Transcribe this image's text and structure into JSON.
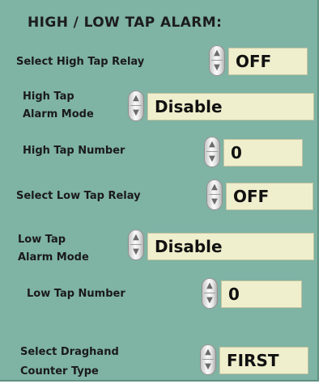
{
  "title": "HIGH / LOW TAP ALARM:",
  "controls": [
    {
      "label": "Select High Tap Relay",
      "value": "OFF"
    },
    {
      "label_lines": [
        "High Tap",
        "Alarm Mode"
      ],
      "value": "Disable"
    },
    {
      "label": "High Tap Number",
      "value": "0"
    },
    {
      "label": "Select Low Tap Relay",
      "value": "OFF"
    },
    {
      "label_lines": [
        "Low Tap",
        "Alarm Mode"
      ],
      "value": "Disable"
    },
    {
      "label": "Low Tap Number",
      "value": "0"
    },
    {
      "label_lines": [
        "Select Draghand",
        "Counter Type"
      ],
      "value": "FIRST"
    }
  ],
  "colors": {
    "panel": "#7fb3a4",
    "field": "#f0efcd"
  }
}
